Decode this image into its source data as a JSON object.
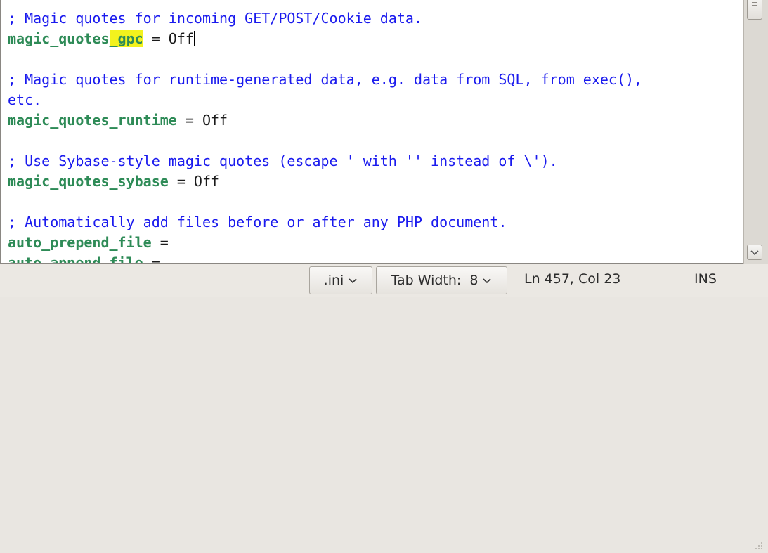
{
  "editor": {
    "lines": [
      [
        {
          "t": "; Magic quotes for incoming GET/POST/Cookie data.",
          "c": "comment"
        }
      ],
      [
        {
          "t": "magic_quotes",
          "c": "key"
        },
        {
          "t": "_gpc",
          "c": "key hl"
        },
        {
          "t": " = Off",
          "c": "plain"
        },
        {
          "t": "",
          "c": "cursor"
        }
      ],
      [],
      [
        {
          "t": "; Magic quotes for runtime-generated data, e.g. data from SQL, from exec(),",
          "c": "comment"
        }
      ],
      [
        {
          "t": "etc.",
          "c": "comment"
        }
      ],
      [
        {
          "t": "magic_quotes_runtime",
          "c": "key"
        },
        {
          "t": " = Off",
          "c": "plain"
        }
      ],
      [],
      [
        {
          "t": "; Use Sybase-style magic quotes (escape ' with '' instead of \\').",
          "c": "comment"
        }
      ],
      [
        {
          "t": "magic_quotes_sybase",
          "c": "key"
        },
        {
          "t": " = Off",
          "c": "plain"
        }
      ],
      [],
      [
        {
          "t": "; Automatically add files before or after any PHP document.",
          "c": "comment"
        }
      ],
      [
        {
          "t": "auto_prepend_file",
          "c": "key"
        },
        {
          "t": " =",
          "c": "plain"
        }
      ],
      [
        {
          "t": "auto_append_file",
          "c": "key"
        },
        {
          "t": " =",
          "c": "plain"
        }
      ]
    ]
  },
  "statusbar": {
    "language": ".ini",
    "tab_width": "Tab Width:  8",
    "position": "Ln 457, Col 23",
    "mode": "INS",
    "chevron": "⌄"
  },
  "icons": {
    "language_dropdown": "chevron-down-icon",
    "tab_width_dropdown": "chevron-down-icon",
    "scroll_down": "chevron-down-icon",
    "resize": "resize-grip-icon"
  }
}
